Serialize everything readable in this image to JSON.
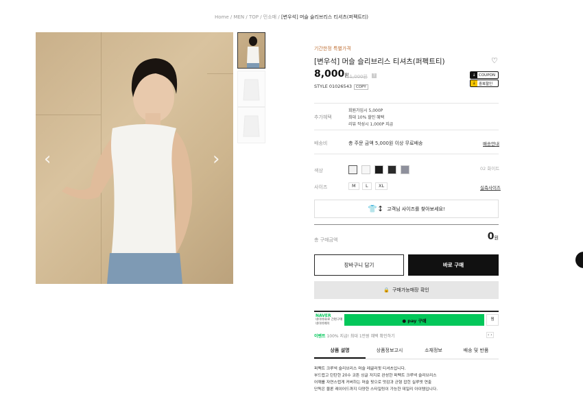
{
  "breadcrumb": {
    "items": [
      "Home",
      "MEN",
      "TOP",
      "민소매"
    ],
    "current": "[변우석] 머슬 슬리브리스 티셔츠(퍼펙트티)",
    "sep": " / "
  },
  "gallery": {
    "prev_icon": "‹",
    "next_icon": "›"
  },
  "product": {
    "promo_label": "기간한정 특별가격",
    "title": "[변우석] 머슬 슬리브리스 티셔츠(퍼펙트티)",
    "price": "8,000",
    "price_unit": "원",
    "original_price": "11,000원",
    "style_label": "STYLE",
    "style_code": "01026543",
    "copy_label": "COPY",
    "coupon_badge": "COUPON",
    "discount_badge": "중복할인"
  },
  "benefits": {
    "label": "추가혜택",
    "lines": [
      "회원가입시 5,000P",
      "최대 10% 할인 혜택",
      "리뷰 작성시 1,000P 지급"
    ]
  },
  "shipping": {
    "label": "배송비",
    "text": "총 주문 금액 5,000원 이상 무료배송",
    "link": "배송안내"
  },
  "color": {
    "label": "색상",
    "selected_name": "02 화이트",
    "swatches": [
      "#f2f2f2",
      "#f7f7f7",
      "#1c1c1c",
      "#2b2b2b",
      "#8e909c"
    ]
  },
  "size": {
    "label": "사이즈",
    "options": [
      "M",
      "L",
      "XL"
    ],
    "guide": "실측사이즈"
  },
  "find_size": "고객님 사이즈를 찾아보세요!",
  "total": {
    "label": "총 구매금액",
    "value": "0",
    "unit": "원"
  },
  "actions": {
    "cart": "장바구니 담기",
    "buy": "바로 구매",
    "stock": "구매가능매장 확인"
  },
  "naver": {
    "logo": "NAVER",
    "sub": "네이버ID로 간편구매 네이버페이",
    "pay": "● pay 구매",
    "zzim": "찜",
    "event_brand": "이벤트",
    "event_text": "100% 지급! 최대 1만원 혜택 확인하기",
    "pager": "‹ ›"
  },
  "tabs": [
    "상품 설명",
    "상품정보고시",
    "소재정보",
    "배송 및 반품"
  ],
  "description": [
    "퍼펙트 크루넥 슬리브리스 머슬 레귤러핏 티셔츠입니다.",
    "부드럽고 탄탄한 20수 코튼 싱글 저지로 완성한 퍼펙트 크루넥 슬리브리스",
    "어깨를 자연스럽게 커버하는 머슬 핏으로 멋감과 균형 잡힌 실루엣 연출",
    "단독은 물론 레이어드까지 다양한 스타일링이 가능한 데일리 아이템입니다."
  ]
}
